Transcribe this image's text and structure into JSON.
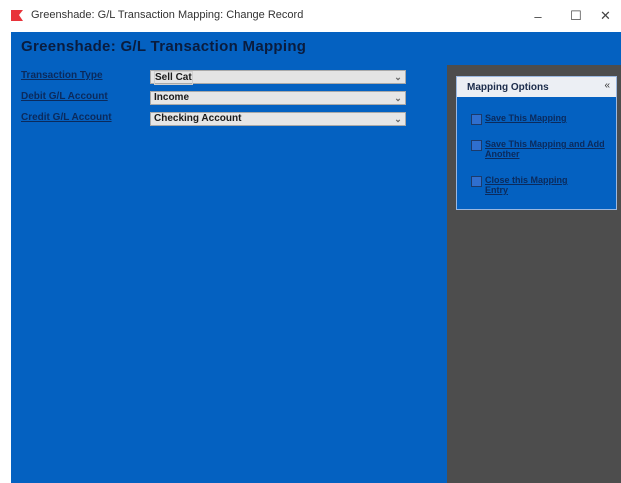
{
  "window": {
    "title": "Greenshade: G/L Transaction Mapping: Change Record",
    "controls": {
      "minimize": "–",
      "maximize": "☐",
      "close": "✕"
    }
  },
  "page": {
    "heading": "Greenshade: G/L Transaction Mapping"
  },
  "form": {
    "transaction_type": {
      "label": "Transaction Type",
      "value": "Sell Cat"
    },
    "debit_account": {
      "label": "Debit G/L Account",
      "value": "Income"
    },
    "credit_account": {
      "label": "Credit G/L Account",
      "value": "Checking Account"
    }
  },
  "options": {
    "title": "Mapping Options",
    "collapse": "«",
    "items": [
      {
        "label": "Save This Mapping"
      },
      {
        "label": "Save This Mapping and Add Another"
      },
      {
        "label": "Close this Mapping Entry"
      }
    ]
  },
  "colors": {
    "primary_blue": "#0461c1",
    "sidebar_gray": "#4d4d4d",
    "heading_text": "#0a1c3e",
    "brand_red": "#e8333a"
  }
}
